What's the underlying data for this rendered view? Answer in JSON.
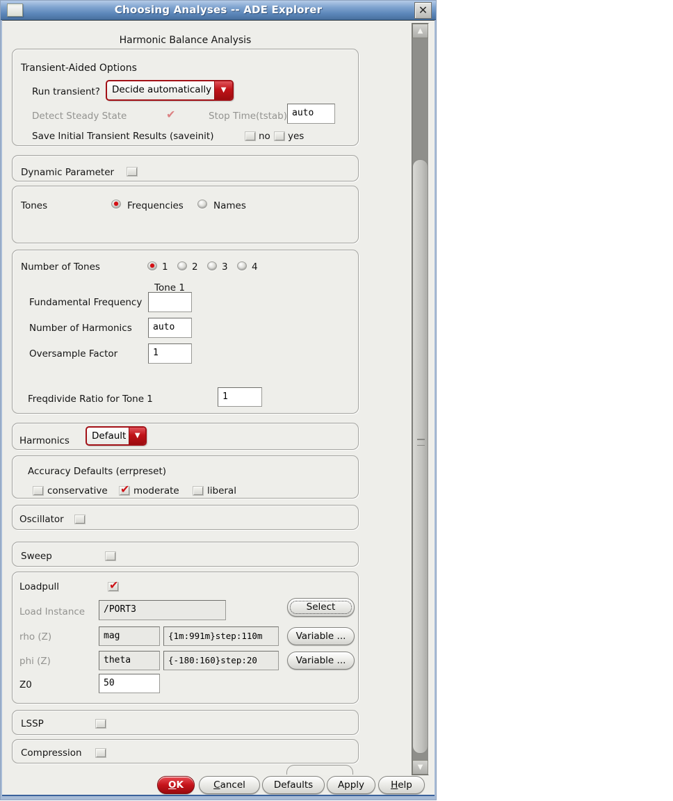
{
  "window": {
    "title": "Choosing Analyses -- ADE Explorer",
    "heading": "Harmonic Balance Analysis"
  },
  "icons": {
    "close": "✕",
    "dropdown_arrow": "▼",
    "scroll_up": "▲",
    "scroll_down": "▼",
    "check": "✔"
  },
  "transient": {
    "group_label": "Transient-Aided Options",
    "run_label": "Run transient?",
    "run_value": "Decide automatically",
    "detect_label": "Detect Steady State",
    "detect_checked": true,
    "stop_label": "Stop Time(tstab)",
    "stop_value": "auto",
    "saveinit_label": "Save Initial Transient Results (saveinit)",
    "no_label": "no",
    "yes_label": "yes"
  },
  "dynamic_param": {
    "label": "Dynamic Parameter",
    "checked": false
  },
  "tones": {
    "label": "Tones",
    "options": [
      "Frequencies",
      "Names"
    ],
    "selected": "Frequencies"
  },
  "num_tones": {
    "label": "Number of Tones",
    "options": [
      "1",
      "2",
      "3",
      "4"
    ],
    "selected": "1",
    "tone_header": "Tone 1",
    "fundamental_label": "Fundamental Frequency",
    "fundamental_value": "",
    "harmonics_label": "Number of Harmonics",
    "harmonics_value": "auto",
    "oversample_label": "Oversample Factor",
    "oversample_value": "1",
    "freqdivide_label": "Freqdivide Ratio for Tone 1",
    "freqdivide_value": "1"
  },
  "harmonics": {
    "label": "Harmonics",
    "value": "Default"
  },
  "accuracy": {
    "label": "Accuracy Defaults (errpreset)",
    "options": [
      "conservative",
      "moderate",
      "liberal"
    ],
    "checked": "moderate"
  },
  "oscillator": {
    "label": "Oscillator",
    "checked": false
  },
  "sweep": {
    "label": "Sweep",
    "checked": false
  },
  "loadpull": {
    "label": "Loadpull",
    "checked": true,
    "load_instance_label": "Load Instance",
    "load_instance_value": "/PORT3",
    "select_button": "Select",
    "rho_label": "rho (Z)",
    "rho_param": "mag",
    "rho_range": "{1m:991m}step:110m",
    "phi_label": "phi (Z)",
    "phi_param": "theta",
    "phi_range": "{-180:160}step:20",
    "variable_button": "Variable ...",
    "z0_label": "Z0",
    "z0_value": "50"
  },
  "lssp": {
    "label": "LSSP",
    "checked": false
  },
  "compression": {
    "label": "Compression",
    "checked": false
  },
  "footer": {
    "ok": "OK",
    "cancel": "Cancel",
    "defaults": "Defaults",
    "apply": "Apply",
    "help": "Help"
  },
  "colors": {
    "accent_red": "#c41219",
    "titlebar_top": "#97b4d9",
    "titlebar_bottom": "#41699c",
    "dialog_bg": "#eeeeea"
  }
}
